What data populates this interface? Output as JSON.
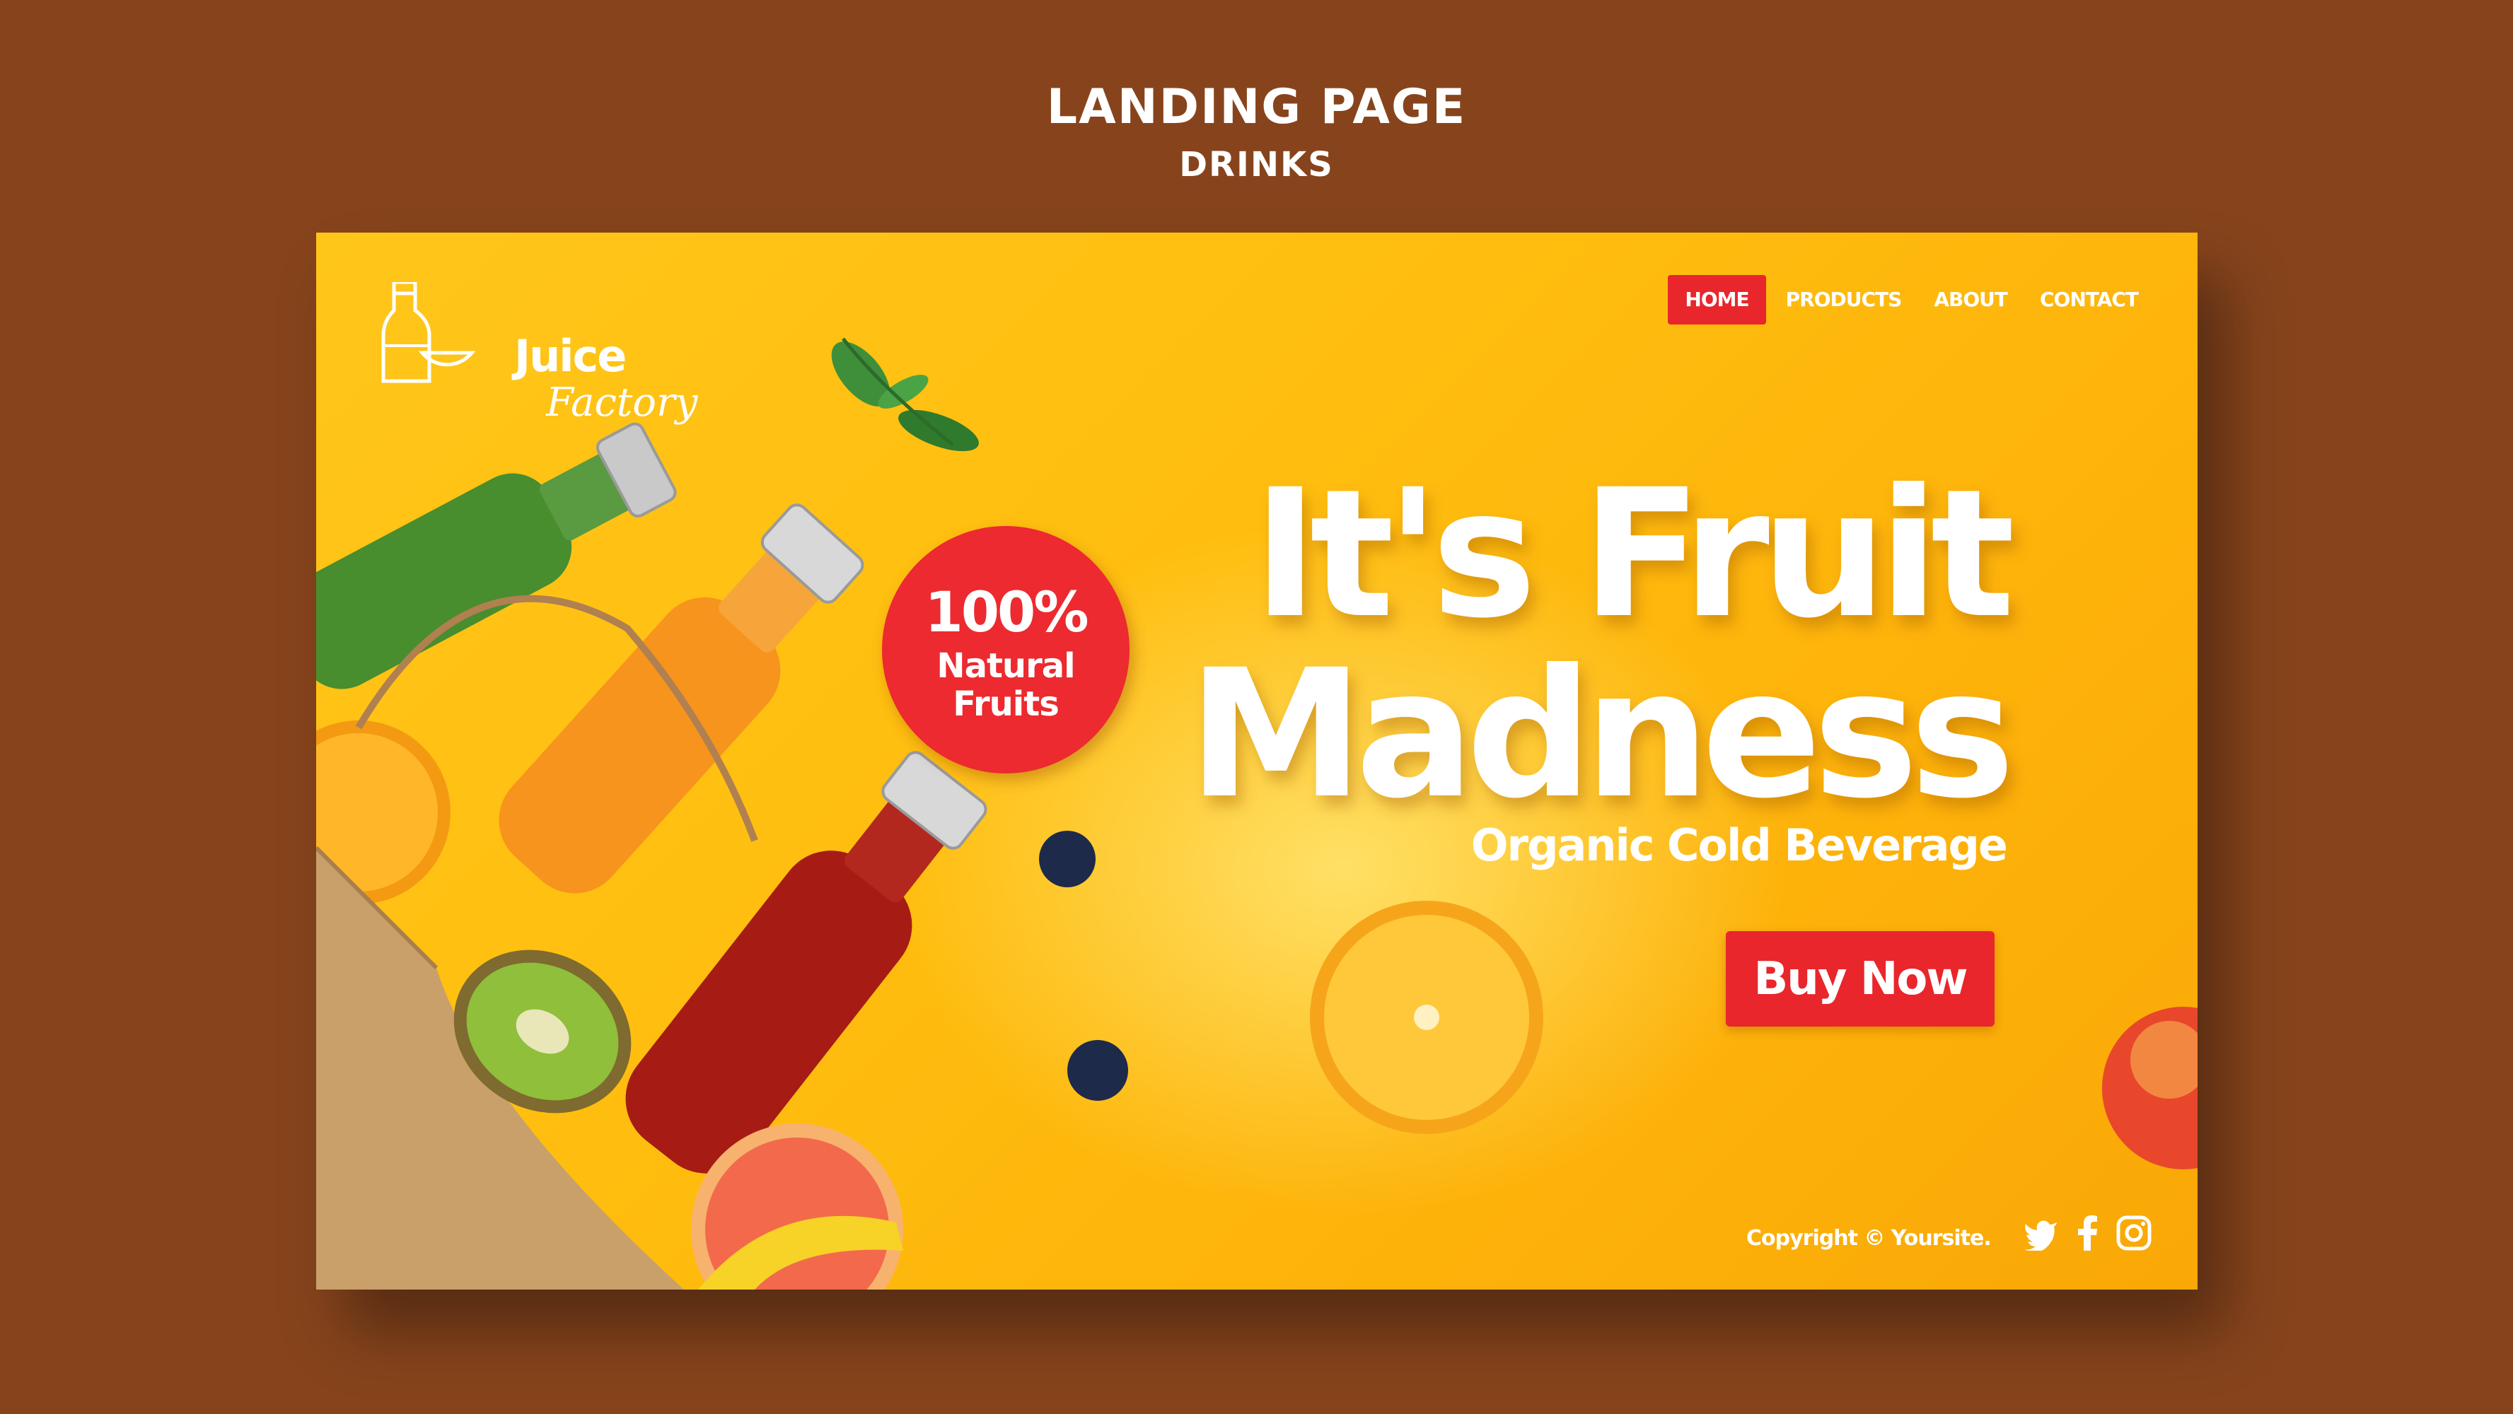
{
  "header": {
    "title": "LANDING PAGE",
    "subtitle": "DRINKS"
  },
  "logo": {
    "line1": "Juice",
    "line2": "Factory",
    "icon": "juice-bottle-lemon-icon"
  },
  "nav": {
    "items": [
      {
        "label": "HOME",
        "active": true
      },
      {
        "label": "PRODUCTS",
        "active": false
      },
      {
        "label": "ABOUT",
        "active": false
      },
      {
        "label": "CONTACT",
        "active": false
      }
    ]
  },
  "hero": {
    "line1": "It's Fruit",
    "line2": "Madness",
    "subtitle": "Organic Cold Beverage",
    "cta": "Buy Now"
  },
  "badge": {
    "percent": "100%",
    "line1": "Natural",
    "line2": "Fruits"
  },
  "footer": {
    "copyright": "Copyright © Yoursite.",
    "social": [
      "twitter-icon",
      "facebook-icon",
      "instagram-icon"
    ]
  },
  "colors": {
    "page_bg": "#87441c",
    "card_yellow": "#ffc61a",
    "accent_red": "#e8262c",
    "text_white": "#ffffff"
  }
}
